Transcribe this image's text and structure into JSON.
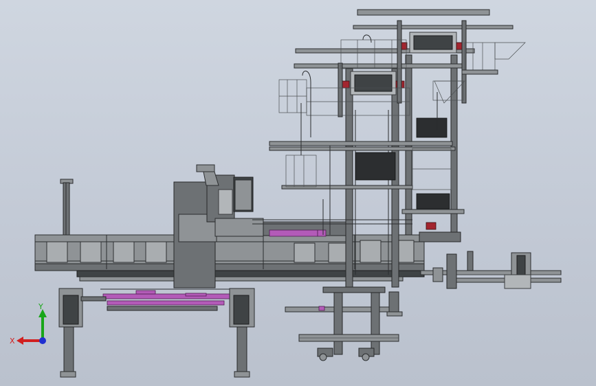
{
  "viewer": {
    "background_top": "#cfd6e0",
    "background_bottom": "#bac1cd"
  },
  "triad": {
    "x_label": "X",
    "y_label": "Y",
    "x_color": "#d11f1f",
    "y_color": "#19a619",
    "z_color": "#1f2fd1"
  },
  "model": {
    "steel_color": "#8f9396",
    "accent_magenta": "#b35bb8",
    "accent_red": "#a2252f"
  }
}
